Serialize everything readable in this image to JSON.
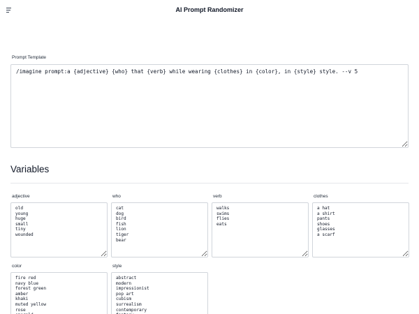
{
  "header": {
    "menu_icon": "menu-icon",
    "title": "AI Prompt Randomizer"
  },
  "template": {
    "label": "Prompt Template",
    "value": "/imagine prompt:a {adjective} {who} that {verb} while wearing {clothes} in {color}, in {style} style. --v 5"
  },
  "variables": {
    "title": "Variables",
    "adjective": {
      "label": "adjective",
      "value": "old\nyoung\nhuge\nsmall\ntiny\nwounded"
    },
    "who": {
      "label": "who",
      "value": "cat\ndog\nbird\nfish\nlion\ntiger\nbear"
    },
    "verb": {
      "label": "verb",
      "value": "walks\nswims\nflies\neats"
    },
    "clothes": {
      "label": "clothes",
      "value": "a hat\na shirt\npants\nshoes\nglasses\na scarf"
    },
    "color": {
      "label": "color",
      "value": "fire red\nnavy blue\nforest green\namber\nkhaki\nmuted yellow\nrose\nemerald"
    },
    "style": {
      "label": "style",
      "value": "abstract\nmodern\nimpressionist\npop art\ncubism\nsurrealism\ncontemporary\nfantasy"
    }
  }
}
